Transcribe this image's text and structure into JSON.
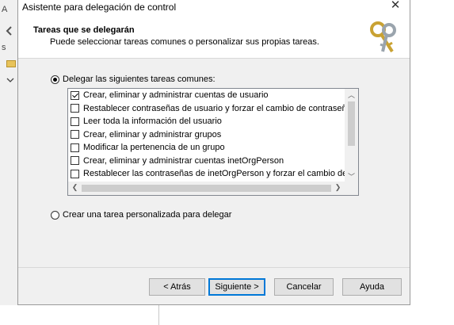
{
  "dialog": {
    "title": "Asistente para delegación de control",
    "close_label": "✕",
    "header_title": "Tareas que se delegarán",
    "header_subtitle": "Puede seleccionar tareas comunes o personalizar sus propias tareas."
  },
  "options": {
    "common": {
      "label": "Delegar las siguientes tareas comunes:",
      "selected": true
    },
    "custom": {
      "label": "Crear una tarea personalizada para delegar",
      "selected": false
    }
  },
  "tasks": [
    {
      "label": "Crear, eliminar y administrar cuentas de usuario",
      "checked": true
    },
    {
      "label": "Restablecer contraseñas de usuario y forzar el cambio de contraseña",
      "checked": false
    },
    {
      "label": "Leer toda la información del usuario",
      "checked": false
    },
    {
      "label": "Crear, eliminar y administrar grupos",
      "checked": false
    },
    {
      "label": "Modificar la pertenencia de un grupo",
      "checked": false
    },
    {
      "label": "Crear, eliminar y administrar cuentas inetOrgPerson",
      "checked": false
    },
    {
      "label": "Restablecer las contraseñas de inetOrgPerson y forzar el cambio de contraseña",
      "checked": false
    }
  ],
  "buttons": {
    "back": "< Atrás",
    "next": "Siguiente >",
    "cancel": "Cancelar",
    "help": "Ayuda"
  },
  "background": {
    "mark_a": "A",
    "mark_s": "s"
  }
}
